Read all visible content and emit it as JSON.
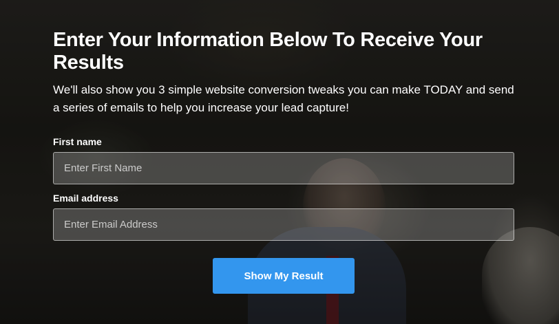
{
  "page": {
    "headline": "Enter Your Information Below To Receive Your Results",
    "subtext": "We'll also show you 3 simple website conversion tweaks you can make TODAY and send a series of emails to help you increase your lead capture!"
  },
  "form": {
    "first_name": {
      "label": "First name",
      "placeholder": "Enter First Name",
      "value": ""
    },
    "email": {
      "label": "Email address",
      "placeholder": "Enter Email Address",
      "value": ""
    },
    "submit_label": "Show My Result"
  },
  "colors": {
    "button_background": "#3396ee",
    "text": "#ffffff",
    "overlay": "rgba(0,0,0,0.45)"
  }
}
